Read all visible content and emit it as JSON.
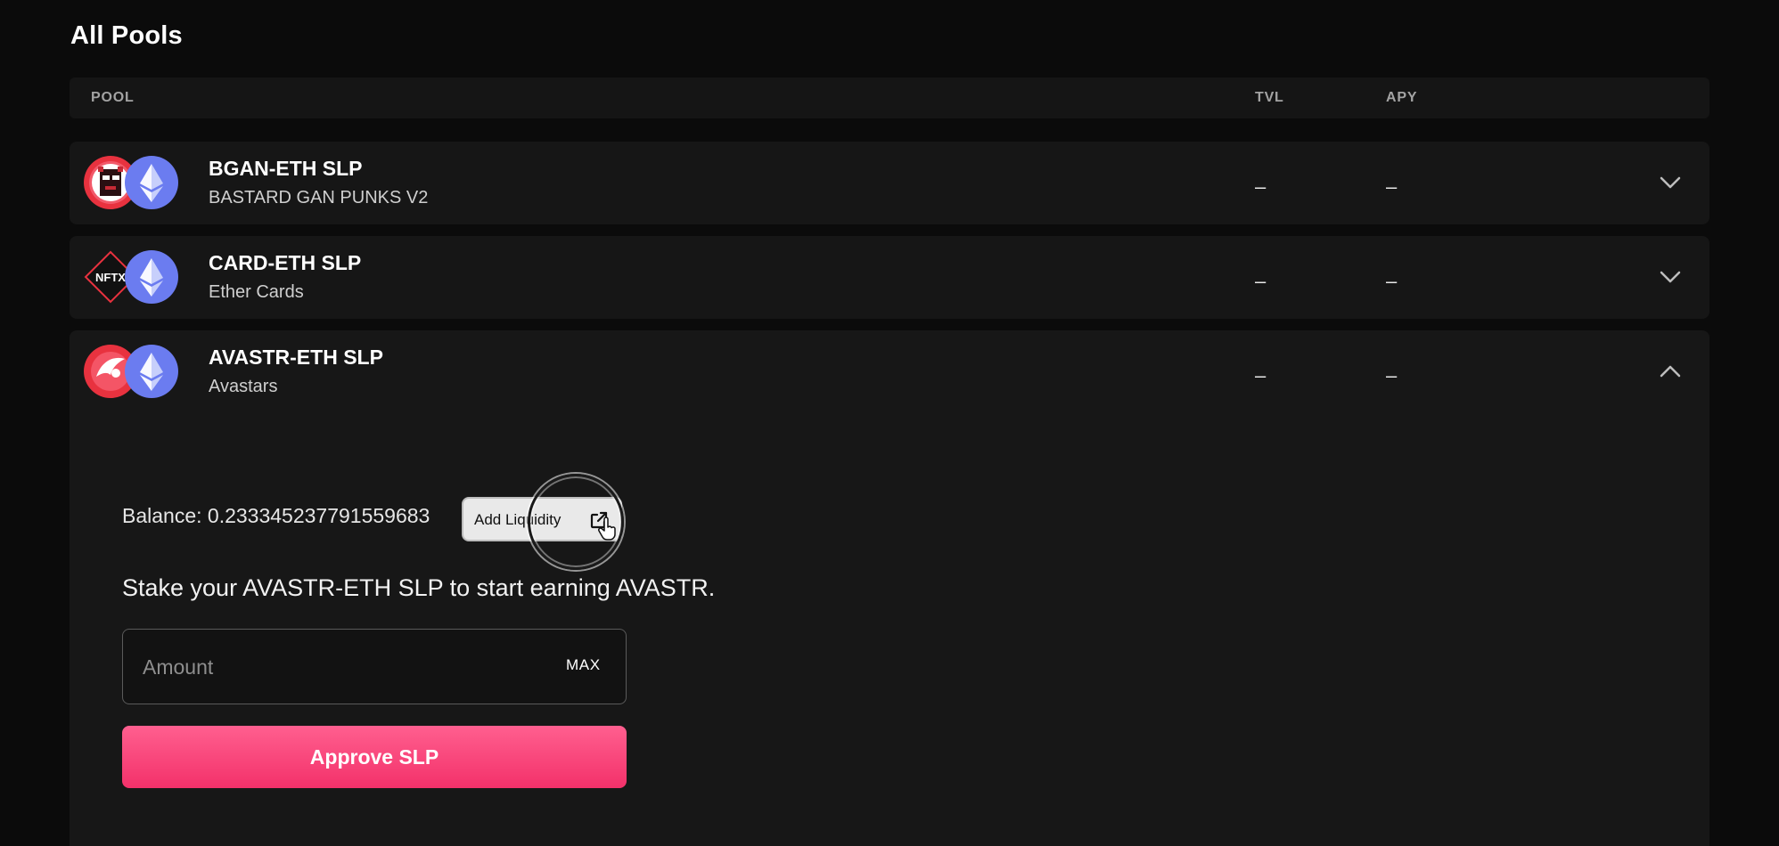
{
  "page": {
    "title": "All Pools"
  },
  "table": {
    "headers": {
      "pool": "POOL",
      "tvl": "TVL",
      "apy": "APY"
    }
  },
  "pools": [
    {
      "name": "BGAN-ETH SLP",
      "subtitle": "BASTARD GAN PUNKS V2",
      "tvl": "–",
      "apy": "–",
      "token_icon": "bgan-punk-icon",
      "expanded": false
    },
    {
      "name": "CARD-ETH SLP",
      "subtitle": "Ether Cards",
      "tvl": "–",
      "apy": "–",
      "token_icon": "nftx-icon",
      "expanded": false
    },
    {
      "name": "AVASTR-ETH SLP",
      "subtitle": "Avastars",
      "tvl": "–",
      "apy": "–",
      "token_icon": "avastar-icon",
      "expanded": true
    }
  ],
  "expanded_panel": {
    "balance_text": "Balance: 0.233345237791559683",
    "add_liquidity_label": "Add Liquidity",
    "stake_text": "Stake your AVASTR-ETH SLP to start earning AVASTR.",
    "amount_placeholder": "Amount",
    "max_label": "MAX",
    "approve_label": "Approve SLP"
  },
  "colors": {
    "background": "#0b0b0b",
    "row": "#161616",
    "accent": "#f3316a",
    "eth": "#6b7cf0",
    "token_red": "#e8323f"
  }
}
